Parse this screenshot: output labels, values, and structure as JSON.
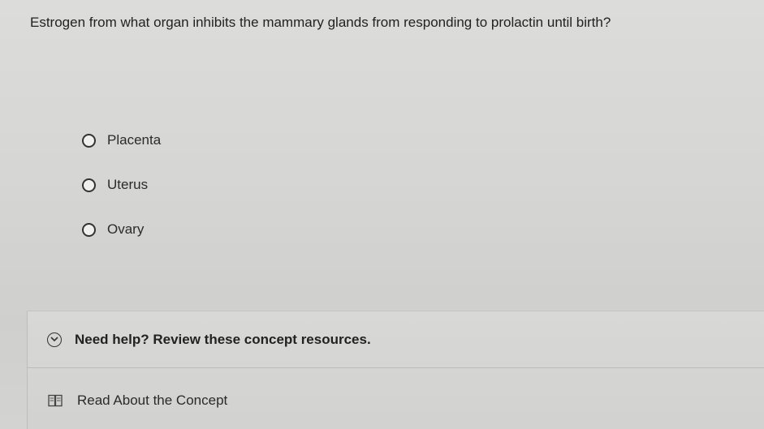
{
  "question": {
    "text": "Estrogen from what organ inhibits the mammary glands from responding to prolactin until birth?"
  },
  "options": [
    {
      "label": "Placenta"
    },
    {
      "label": "Uterus"
    },
    {
      "label": "Ovary"
    }
  ],
  "help": {
    "title": "Need help? Review these concept resources.",
    "icon": "chevron-down-icon",
    "resources": [
      {
        "label": "Read About the Concept",
        "icon": "book-icon"
      }
    ]
  }
}
